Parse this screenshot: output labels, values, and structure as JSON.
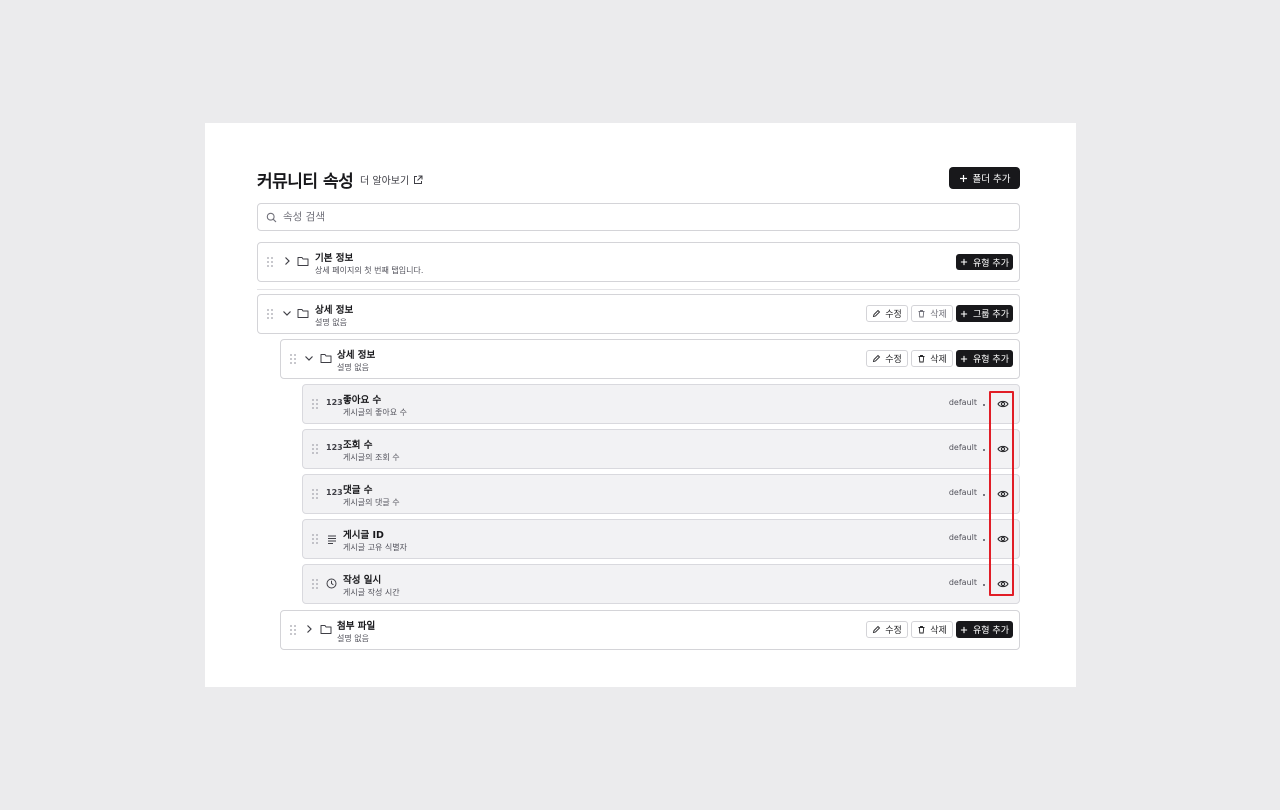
{
  "header": {
    "title": "커뮤니티 속성",
    "learn_more": "더 알아보기",
    "add_folder": "폴더 추가"
  },
  "search": {
    "placeholder": "속성 검색",
    "value": ""
  },
  "labels": {
    "edit": "수정",
    "delete": "삭제",
    "add_type": "유형 추가",
    "add_group": "그룹 추가"
  },
  "folders": [
    {
      "name": "기본 정보",
      "description": "상세 페이지의 첫 번째 탭입니다."
    },
    {
      "name": "상세 정보",
      "description": "설명 없음"
    },
    {
      "name": "상세 정보",
      "description": "설명 없음"
    },
    {
      "name": "첨부 파일",
      "description": "설명 없음"
    }
  ],
  "fields": [
    {
      "icon": "123",
      "name": "좋아요 수",
      "description": "게시글의 좋아요 수",
      "tag": "default"
    },
    {
      "icon": "123",
      "name": "조회 수",
      "description": "게시글의 조회 수",
      "tag": "default"
    },
    {
      "icon": "123",
      "name": "댓글 수",
      "description": "게시글의 댓글 수",
      "tag": "default"
    },
    {
      "icon": "text-lines-icon",
      "name": "게시글 ID",
      "description": "게시글 고유 식별자",
      "tag": "default"
    },
    {
      "icon": "clock-icon",
      "name": "작성 일시",
      "description": "게시글 작성 시간",
      "tag": "default"
    }
  ],
  "colors": {
    "accent": "#18181b",
    "highlight": "#e11d26",
    "field_bg": "#f2f2f4"
  }
}
